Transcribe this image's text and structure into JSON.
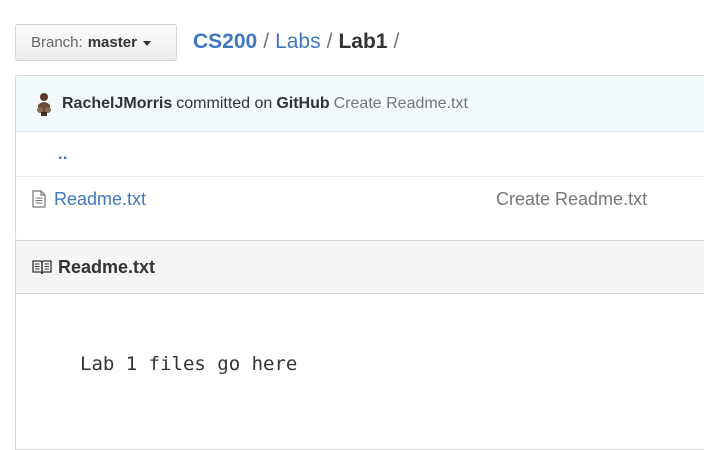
{
  "branch": {
    "prefix": "Branch:",
    "name": "master"
  },
  "breadcrumb": {
    "root": "CS200",
    "sep1": "/",
    "folder": "Labs",
    "sep2": "/",
    "current": "Lab1",
    "sep3": "/"
  },
  "commit": {
    "author": "RachelJMorris",
    "text": "committed on",
    "platform": "GitHub",
    "message": "Create Readme.txt"
  },
  "files": {
    "parent_link": "..",
    "items": [
      {
        "name": "Readme.txt",
        "message": "Create Readme.txt"
      }
    ]
  },
  "readme": {
    "title": "Readme.txt",
    "content": "Lab 1 files go here"
  },
  "icons": {
    "branch_caret": "caret-down-icon",
    "avatar": "avatar",
    "file": "file-text-icon",
    "book": "book-icon"
  }
}
